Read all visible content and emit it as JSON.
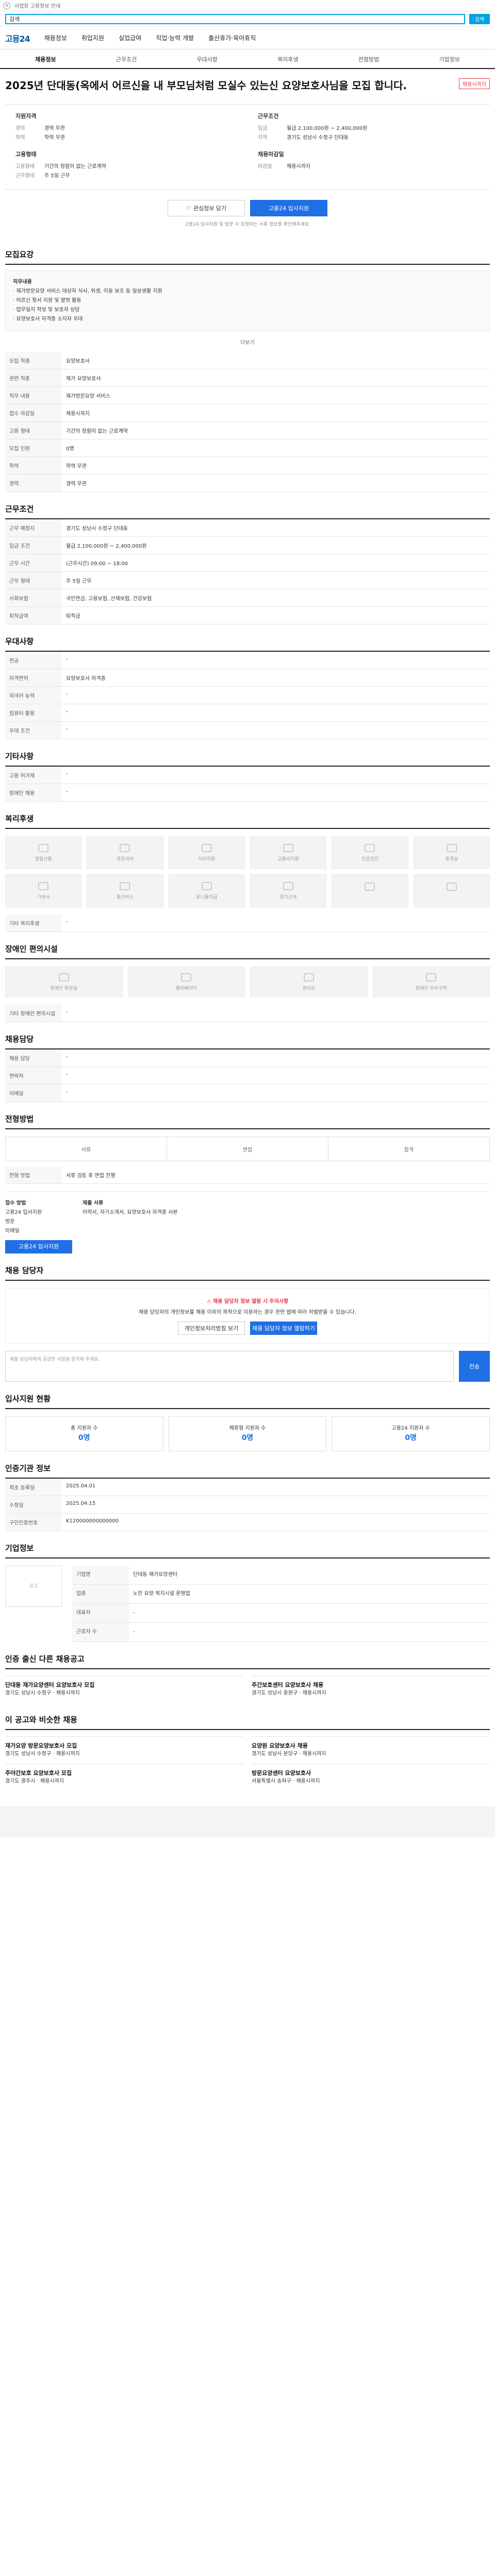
{
  "header": {
    "close": "×",
    "notice": "사업장 고용정보 안내",
    "search_placeholder": "검색",
    "search_button": "검색",
    "logo": "고용24",
    "menu": [
      "채용정보",
      "취업지원",
      "실업급여",
      "직업·능력 개발",
      "출산휴가·육아휴직"
    ]
  },
  "tabs": [
    "채용정보",
    "근무조건",
    "우대사항",
    "복리후생",
    "전형방법",
    "기업정보"
  ],
  "title": "2025년 단대동(옥에서 어르신을 내 부모님처럼 모실수 있는신 요양보호사님을 모집 합니다.",
  "badge": "채용시까지",
  "summary": {
    "left_title": "지원자격",
    "left": [
      [
        "경력",
        "경력 무관"
      ],
      [
        "학력",
        "학력 무관"
      ]
    ],
    "right_title": "근무조건",
    "right": [
      [
        "임금",
        "월급 2,100,000원 ~ 2,400,000원"
      ],
      [
        "지역",
        "경기도 성남시 수정구 단대동"
      ]
    ],
    "left2_title": "고용형태",
    "left2": [
      [
        "고용형태",
        "기간의 정함이 없는 근로계약"
      ],
      [
        "근무형태",
        "주 5일 근무"
      ]
    ],
    "right2_title": "채용마감일",
    "right2": [
      [
        "마감일",
        "채용시까지"
      ]
    ]
  },
  "buttons": {
    "scrap": "관심정보 담기",
    "apply": "고용24 입사지원"
  },
  "note": "고용24 입사지원 및 방문 시 요청하는 서류 정보를 확인해주세요.",
  "sections": {
    "recruit": {
      "title": "모집요강",
      "desc_title": "직무내용",
      "desc": [
        "· 재가방문요양 서비스 대상자 식사, 위생, 이동 보조 등 일상생활 지원",
        "· 어르신 정서 지원 및 말벗 활동",
        "· 업무일지 작성 및 보호자 상담",
        "· 요양보호사 자격증 소지자 우대"
      ],
      "more": "더보기",
      "rows": [
        [
          "모집 직종",
          "요양보호사"
        ],
        [
          "관련 직종",
          "재가 요양보호사"
        ],
        [
          "직무 내용",
          "재가방문요양 서비스"
        ],
        [
          "접수 마감일",
          "채용시까지"
        ],
        [
          "고용 형태",
          "기간의 정함이 없는 근로계약"
        ],
        [
          "모집 인원",
          "0명"
        ],
        [
          "학력",
          "학력 무관"
        ],
        [
          "경력",
          "경력 무관"
        ]
      ]
    },
    "work": {
      "title": "근무조건",
      "rows": [
        [
          "근무 예정지",
          "경기도 성남시 수정구 단대동"
        ],
        [
          "임금 조건",
          "월급 2,100,000원 ~ 2,400,000원"
        ],
        [
          "근무 시간",
          "(근무시간) 09:00 ~ 18:00"
        ],
        [
          "근무 형태",
          "주 5일 근무"
        ],
        [
          "사회보험",
          "국민연금, 고용보험, 산재보험, 건강보험"
        ],
        [
          "퇴직급여",
          "퇴직금"
        ]
      ]
    },
    "prefer": {
      "title": "우대사항",
      "rows": [
        [
          "전공",
          "-"
        ],
        [
          "자격면허",
          "요양보호사 자격증"
        ],
        [
          "외국어 능력",
          "-"
        ],
        [
          "컴퓨터 활용",
          "-"
        ],
        [
          "우대 조건",
          "-"
        ]
      ]
    },
    "etc": {
      "title": "기타사항",
      "rows": [
        [
          "고용 허가제",
          "-"
        ],
        [
          "장애인 채용",
          "-"
        ]
      ]
    },
    "welfare": {
      "title": "복리후생",
      "items": [
        "명절선물",
        "경조사비",
        "식비지원",
        "교통비지원",
        "건강검진",
        "휴게실",
        "기숙사",
        "통근버스",
        "유니폼지급",
        "장기근속",
        "-",
        "-"
      ],
      "etc_title": "기타 복리후생",
      "etc": "-"
    },
    "disability": {
      "title": "장애인 편의시설",
      "items": [
        "장애인 화장실",
        "엘리베이터",
        "경사로",
        "장애인 주차구역"
      ],
      "etc_title": "기타 장애인 편의시설",
      "etc": "-"
    },
    "hr": {
      "title": "채용담당",
      "rows": [
        [
          "채용 담당",
          "-"
        ],
        [
          "연락처",
          "-"
        ],
        [
          "이메일",
          "-"
        ]
      ]
    },
    "process": {
      "title": "전형방법",
      "steps": [
        "서류",
        "면접",
        "합격"
      ],
      "subtitle": "전형 방법",
      "method": "서류 검토 후 면접 진행",
      "apply_title": "접수 방법",
      "apply_methods": [
        "고용24 입사지원",
        "방문",
        "이메일"
      ],
      "doc_title": "제출 서류",
      "docs": "이력서, 자기소개서, 요양보호사 자격증 사본"
    },
    "qna": {
      "title": "채용 담당자",
      "warn": "채용 담당자 정보 열람 시 주의사항",
      "warn_desc": "채용 담당자의 개인정보를 채용 이외의 목적으로 이용하는 경우 관련 법에 따라 처벌받을 수 있습니다.",
      "btn1": "개인정보처리방침 보기",
      "btn2": "채용 담당자 정보 열람하기",
      "placeholder": "채용 담당자에게 궁금한 사항을 문의해 주세요.",
      "submit": "전송"
    },
    "stats": {
      "title": "입사지원 현황",
      "items": [
        [
          "총 지원자 수",
          "0명"
        ],
        [
          "체류형 지원자 수",
          "0명"
        ],
        [
          "고용24 지원자 수",
          "0명"
        ]
      ]
    },
    "info": {
      "title": "인증기관 정보",
      "rows": [
        [
          "최초 등록일",
          "2025.04.01"
        ],
        [
          "수정일",
          "2025.04.15"
        ],
        [
          "구인인증번호",
          "K120000000000000"
        ]
      ]
    },
    "company": {
      "title": "기업정보",
      "name": "단대동 재가요양센터",
      "logo": "로고",
      "rows": [
        [
          "기업명",
          "단대동 재가요양센터"
        ],
        [
          "업종",
          "노인 요양 복지시설 운영업"
        ],
        [
          "대표자",
          "-"
        ],
        [
          "근로자 수",
          "-"
        ]
      ]
    },
    "others": {
      "title": "인증 출신 다른 채용공고",
      "cards": [
        {
          "t": "단대동 재가요양센터 요양보호사 모집",
          "s": "경기도 성남시 수정구 · 채용시까지"
        },
        {
          "t": "주간보호센터 요양보호사 채용",
          "s": "경기도 성남시 중원구 · 채용시까지"
        }
      ]
    },
    "near": {
      "title": "이 공고와 비슷한 채용",
      "cards": [
        {
          "t": "재가요양 방문요양보호사 모집",
          "s": "경기도 성남시 수정구 · 채용시까지"
        },
        {
          "t": "요양원 요양보호사 채용",
          "s": "경기도 성남시 분당구 · 채용시까지"
        },
        {
          "t": "주야간보호 요양보호사 모집",
          "s": "경기도 광주시 · 채용시까지"
        },
        {
          "t": "방문요양센터 요양보호사",
          "s": "서울특별시 송파구 · 채용시까지"
        }
      ]
    }
  }
}
